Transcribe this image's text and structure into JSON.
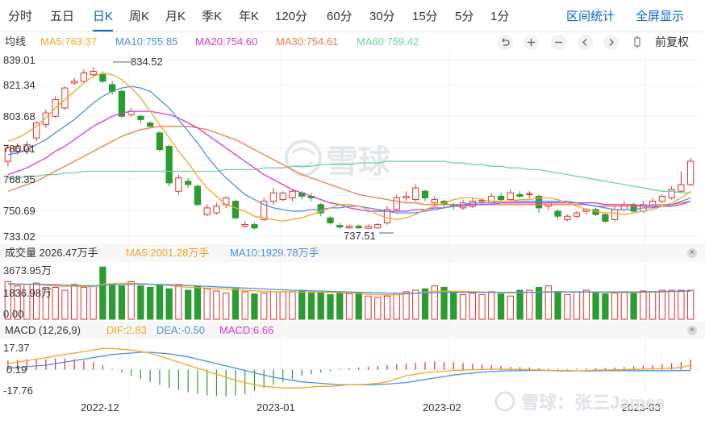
{
  "tabs": [
    {
      "label": "分时",
      "active": false
    },
    {
      "label": "五日",
      "active": false
    },
    {
      "label": "日K",
      "active": true
    },
    {
      "label": "周K",
      "active": false
    },
    {
      "label": "月K",
      "active": false
    },
    {
      "label": "季K",
      "active": false
    },
    {
      "label": "年K",
      "active": false
    },
    {
      "label": "120分",
      "active": false
    },
    {
      "label": "60分",
      "active": false
    },
    {
      "label": "30分",
      "active": false
    },
    {
      "label": "15分",
      "active": false
    },
    {
      "label": "5分",
      "active": false
    },
    {
      "label": "1分",
      "active": false
    }
  ],
  "tools": {
    "interval_stats": "区间统计",
    "fullscreen": "全屏显示"
  },
  "ma_bar": {
    "title": "均线",
    "ma5": "MA5:763.37",
    "ma10": "MA10:755.85",
    "ma20": "MA20:754.60",
    "ma30": "MA30:754.61",
    "ma60": "MA60:759.42",
    "adjust": "前复权"
  },
  "controls": [
    "undo-icon",
    "zoom-in-icon",
    "zoom-out-icon",
    "chevron-left-icon",
    "chevron-right-icon",
    "drag-handle-icon"
  ],
  "price_axis": [
    "839.01",
    "821.34",
    "803.68",
    "786.01",
    "768.35",
    "750.69",
    "733.02"
  ],
  "annotations": {
    "high": "834.52",
    "low": "737.51"
  },
  "watermark": "雪球",
  "volume": {
    "title": "成交量 2026.47万手",
    "ma5": "MA5:2001.28万手",
    "ma10": "MA10:1929.78万手",
    "axis_top": "3673.95万",
    "axis_mid": "1836.98万",
    "axis_bottom": "0.00"
  },
  "macd": {
    "title": "MACD (12,26,9)",
    "dif": "DIF:2.83",
    "dea": "DEA:-0.50",
    "macd": "MACD:6.66",
    "axis_top": "17.37",
    "axis_mid": "0.19",
    "axis_bottom": "-17.76"
  },
  "x_axis": [
    "2022-12",
    "2023-01",
    "2023-02",
    "2023-03"
  ],
  "footer_watermark": "雪球：张三James",
  "colors": {
    "up": "#e0312e",
    "down": "#2a9c30",
    "accent": "#0066cc",
    "ma5": "#f5a623",
    "ma10": "#4a90e2",
    "ma20": "#d63ad1",
    "ma30": "#f07c4c",
    "ma60": "#6fd39a"
  },
  "chart_data": {
    "type": "candlestick",
    "price_range": [
      733.02,
      839.01
    ],
    "candles": [
      {
        "o": 778,
        "c": 786,
        "h": 788,
        "l": 775
      },
      {
        "o": 784,
        "c": 787,
        "h": 789,
        "l": 782
      },
      {
        "o": 784,
        "c": 788,
        "h": 790,
        "l": 782
      },
      {
        "o": 792,
        "c": 801,
        "h": 802,
        "l": 790
      },
      {
        "o": 800,
        "c": 807,
        "h": 809,
        "l": 798
      },
      {
        "o": 805,
        "c": 815,
        "h": 817,
        "l": 804
      },
      {
        "o": 810,
        "c": 822,
        "h": 823,
        "l": 809
      },
      {
        "o": 825,
        "c": 826,
        "h": 828,
        "l": 824
      },
      {
        "o": 826,
        "c": 831,
        "h": 833,
        "l": 825
      },
      {
        "o": 830,
        "c": 832,
        "h": 834.52,
        "l": 829
      },
      {
        "o": 830,
        "c": 826,
        "h": 832,
        "l": 825
      },
      {
        "o": 824,
        "c": 820,
        "h": 826,
        "l": 818
      },
      {
        "o": 820,
        "c": 805,
        "h": 821,
        "l": 804
      },
      {
        "o": 806,
        "c": 808,
        "h": 810,
        "l": 805
      },
      {
        "o": 805,
        "c": 803,
        "h": 806,
        "l": 801
      },
      {
        "o": 801,
        "c": 799,
        "h": 802,
        "l": 798
      },
      {
        "o": 795,
        "c": 785,
        "h": 796,
        "l": 784
      },
      {
        "o": 787,
        "c": 765,
        "h": 788,
        "l": 763
      },
      {
        "o": 760,
        "c": 768,
        "h": 770,
        "l": 758
      },
      {
        "o": 766,
        "c": 764,
        "h": 768,
        "l": 762
      },
      {
        "o": 763,
        "c": 752,
        "h": 764,
        "l": 751
      },
      {
        "o": 746,
        "c": 750,
        "h": 752,
        "l": 745
      },
      {
        "o": 747,
        "c": 751,
        "h": 753,
        "l": 746
      },
      {
        "o": 752,
        "c": 756,
        "h": 757,
        "l": 750
      },
      {
        "o": 754,
        "c": 744,
        "h": 755,
        "l": 743
      },
      {
        "o": 739,
        "c": 740,
        "h": 742,
        "l": 738
      },
      {
        "o": 740,
        "c": 738,
        "h": 741,
        "l": 737
      },
      {
        "o": 743,
        "c": 754,
        "h": 756,
        "l": 742
      },
      {
        "o": 754,
        "c": 759,
        "h": 762,
        "l": 752
      },
      {
        "o": 755,
        "c": 759,
        "h": 760,
        "l": 754
      },
      {
        "o": 756,
        "c": 760,
        "h": 761,
        "l": 754
      },
      {
        "o": 759,
        "c": 757,
        "h": 760,
        "l": 755
      },
      {
        "o": 757,
        "c": 756,
        "h": 759,
        "l": 754
      },
      {
        "o": 752,
        "c": 747,
        "h": 753,
        "l": 745
      },
      {
        "o": 744,
        "c": 741,
        "h": 745,
        "l": 740
      },
      {
        "o": 739.5,
        "c": 738.5,
        "h": 741,
        "l": 737.51
      },
      {
        "o": 738,
        "c": 739,
        "h": 740,
        "l": 737.51
      },
      {
        "o": 739,
        "c": 738,
        "h": 740,
        "l": 737.51
      },
      {
        "o": 737.8,
        "c": 739,
        "h": 740,
        "l": 737.51
      },
      {
        "o": 738,
        "c": 740,
        "h": 741,
        "l": 737.6
      },
      {
        "o": 741,
        "c": 749,
        "h": 751,
        "l": 740
      },
      {
        "o": 749,
        "c": 756,
        "h": 758,
        "l": 748
      },
      {
        "o": 756,
        "c": 757,
        "h": 760,
        "l": 754
      },
      {
        "o": 755,
        "c": 762,
        "h": 764,
        "l": 754
      },
      {
        "o": 760,
        "c": 756,
        "h": 761,
        "l": 754
      },
      {
        "o": 753,
        "c": 755,
        "h": 757,
        "l": 751
      },
      {
        "o": 754,
        "c": 752,
        "h": 755,
        "l": 750
      },
      {
        "o": 752,
        "c": 751,
        "h": 753,
        "l": 749
      },
      {
        "o": 750,
        "c": 753,
        "h": 755,
        "l": 749
      },
      {
        "o": 751,
        "c": 754,
        "h": 756,
        "l": 750
      },
      {
        "o": 754,
        "c": 754.5,
        "h": 756,
        "l": 752
      },
      {
        "o": 753,
        "c": 757,
        "h": 759,
        "l": 752
      },
      {
        "o": 757,
        "c": 755,
        "h": 759,
        "l": 754
      },
      {
        "o": 755,
        "c": 759,
        "h": 761,
        "l": 754
      },
      {
        "o": 758,
        "c": 757,
        "h": 760,
        "l": 756
      },
      {
        "o": 758,
        "c": 758.5,
        "h": 760,
        "l": 756
      },
      {
        "o": 757,
        "c": 750,
        "h": 758,
        "l": 747
      },
      {
        "o": 751,
        "c": 753,
        "h": 754,
        "l": 749
      },
      {
        "o": 748,
        "c": 745,
        "h": 749,
        "l": 743
      },
      {
        "o": 743,
        "c": 745,
        "h": 746,
        "l": 742
      },
      {
        "o": 745,
        "c": 747,
        "h": 748,
        "l": 744
      },
      {
        "o": 748,
        "c": 749,
        "h": 750,
        "l": 746
      },
      {
        "o": 749,
        "c": 746,
        "h": 750,
        "l": 745
      },
      {
        "o": 746,
        "c": 742,
        "h": 747,
        "l": 741
      },
      {
        "o": 743,
        "c": 749,
        "h": 751,
        "l": 742
      },
      {
        "o": 749,
        "c": 752,
        "h": 754,
        "l": 748
      },
      {
        "o": 752,
        "c": 748,
        "h": 753,
        "l": 747
      },
      {
        "o": 748,
        "c": 752,
        "h": 754,
        "l": 747
      },
      {
        "o": 751,
        "c": 754,
        "h": 756,
        "l": 750
      },
      {
        "o": 754,
        "c": 757,
        "h": 758,
        "l": 753
      },
      {
        "o": 756,
        "c": 761,
        "h": 763,
        "l": 755
      },
      {
        "o": 760,
        "c": 764,
        "h": 772,
        "l": 759
      },
      {
        "o": 764,
        "c": 778,
        "h": 780,
        "l": 763
      }
    ],
    "ma5": [
      790,
      792,
      795,
      799,
      804,
      810,
      815,
      820,
      825,
      829,
      831,
      830,
      827,
      822,
      816,
      808,
      800,
      792,
      784,
      777,
      769,
      762,
      757,
      752,
      750,
      748,
      745,
      744,
      743,
      742,
      743,
      744,
      746,
      748,
      750,
      752,
      752,
      751,
      749,
      746,
      744,
      743,
      744,
      746,
      749,
      751,
      753,
      755,
      756,
      756,
      755,
      754,
      754,
      754,
      755,
      755,
      756,
      756,
      755,
      753,
      751,
      749,
      748,
      747,
      747,
      746,
      747,
      748,
      749,
      751,
      753,
      756,
      760
    ],
    "ma10": [
      782,
      783,
      785,
      788,
      791,
      795,
      799,
      803,
      808,
      813,
      817,
      820,
      822,
      823,
      822,
      820,
      815,
      810,
      803,
      796,
      789,
      781,
      774,
      768,
      763,
      758,
      755,
      752,
      750,
      749,
      748,
      748,
      749,
      749,
      750,
      750,
      751,
      751,
      750,
      749,
      748,
      747,
      747,
      747,
      748,
      749,
      750,
      751,
      752,
      753,
      753,
      753,
      754,
      754,
      754,
      754,
      754,
      754,
      754,
      754,
      753,
      752,
      751,
      750,
      749,
      749,
      749,
      750,
      750,
      751,
      752,
      754,
      756
    ],
    "ma20": [
      770,
      772,
      774,
      777,
      780,
      784,
      787,
      791,
      795,
      799,
      802,
      805,
      807,
      808,
      808,
      808,
      807,
      806,
      804,
      801,
      798,
      794,
      790,
      786,
      782,
      778,
      774,
      770,
      767,
      764,
      761,
      759,
      757,
      755,
      753,
      752,
      750,
      749,
      748,
      748,
      748,
      748,
      748,
      749,
      749,
      750,
      750,
      751,
      751,
      752,
      752,
      752,
      753,
      753,
      753,
      753,
      753,
      753,
      753,
      753,
      753,
      753,
      753,
      752,
      752,
      752,
      752,
      751,
      751,
      751,
      751,
      752,
      754
    ],
    "ma30": [
      760,
      762,
      764,
      766,
      769,
      772,
      775,
      778,
      781,
      784,
      787,
      790,
      793,
      795,
      797,
      798,
      799,
      799,
      799,
      799,
      798,
      797,
      795,
      793,
      791,
      788,
      785,
      782,
      779,
      776,
      773,
      770,
      768,
      766,
      764,
      762,
      760,
      758,
      757,
      756,
      755,
      754,
      753,
      753,
      752,
      752,
      752,
      752,
      752,
      752,
      752,
      752,
      752,
      752,
      752,
      752,
      752,
      752,
      752,
      752,
      752,
      752,
      751,
      751,
      751,
      751,
      751,
      751,
      752,
      752,
      752,
      753,
      754
    ],
    "ma60": [
      768,
      768,
      769,
      769,
      770,
      770,
      771,
      771,
      772,
      772,
      772,
      772,
      772,
      772,
      772,
      772,
      772,
      772,
      772,
      772,
      772,
      772,
      772,
      773,
      773,
      773,
      773,
      774,
      774,
      774,
      775,
      775,
      775,
      776,
      776,
      776,
      776,
      777,
      777,
      777,
      778,
      778,
      778,
      778,
      778,
      778,
      778,
      777,
      777,
      776,
      776,
      775,
      775,
      774,
      774,
      773,
      773,
      772,
      771,
      770,
      769,
      768,
      767,
      766,
      765,
      764,
      763,
      762,
      761,
      760,
      760,
      759,
      759
    ],
    "volume": [
      2600,
      2300,
      2400,
      2500,
      2200,
      2200,
      2000,
      2400,
      2200,
      2300,
      3600,
      2400,
      2300,
      2600,
      2300,
      2200,
      2400,
      2100,
      2400,
      2000,
      2300,
      2100,
      1950,
      1800,
      2100,
      1900,
      1750,
      1800,
      1900,
      1900,
      1900,
      2000,
      1800,
      1850,
      1700,
      1800,
      1750,
      1850,
      1600,
      1500,
      1600,
      1800,
      1900,
      2000,
      2100,
      2300,
      2200,
      1900,
      1700,
      1800,
      1700,
      1900,
      1750,
      1600,
      2000,
      2000,
      2200,
      2300,
      1850,
      1700,
      1900,
      2000,
      1850,
      1750,
      1800,
      1900,
      1800,
      1950,
      1900,
      2000,
      2000,
      2000,
      2000
    ],
    "volume_ma5": [
      2400,
      2400,
      2400,
      2400,
      2350,
      2300,
      2260,
      2280,
      2250,
      2260,
      2420,
      2460,
      2480,
      2480,
      2460,
      2420,
      2380,
      2320,
      2260,
      2210,
      2180,
      2150,
      2110,
      2080,
      2040,
      2000,
      1960,
      1920,
      1900,
      1880,
      1870,
      1870,
      1870,
      1860,
      1850,
      1830,
      1800,
      1760,
      1720,
      1690,
      1680,
      1690,
      1730,
      1800,
      1870,
      1920,
      1940,
      1930,
      1920,
      1900,
      1880,
      1860,
      1840,
      1820,
      1830,
      1850,
      1870,
      1900,
      1920,
      1900,
      1880,
      1870,
      1860,
      1850,
      1840,
      1830,
      1830,
      1840,
      1860,
      1880,
      1900,
      1920,
      1950
    ],
    "volume_ma10": [
      2450,
      2430,
      2420,
      2410,
      2400,
      2380,
      2360,
      2340,
      2320,
      2300,
      2330,
      2360,
      2390,
      2410,
      2420,
      2410,
      2400,
      2380,
      2350,
      2330,
      2300,
      2270,
      2240,
      2210,
      2180,
      2150,
      2120,
      2090,
      2060,
      2030,
      2000,
      1980,
      1960,
      1940,
      1920,
      1900,
      1880,
      1860,
      1840,
      1820,
      1800,
      1790,
      1790,
      1800,
      1810,
      1830,
      1850,
      1860,
      1860,
      1860,
      1860,
      1860,
      1860,
      1860,
      1860,
      1860,
      1860,
      1870,
      1880,
      1880,
      1880,
      1880,
      1880,
      1880,
      1880,
      1880,
      1880,
      1890,
      1900,
      1910,
      1920,
      1930,
      1940
    ],
    "macd_hist": [
      6,
      6.5,
      7,
      7,
      7,
      7.5,
      7.5,
      7,
      6,
      5,
      3,
      0.5,
      -2,
      -4,
      -6,
      -8,
      -10,
      -12,
      -13.5,
      -15,
      -16,
      -17,
      -17.5,
      -17.76,
      -17,
      -16,
      -14,
      -12,
      -10,
      -8,
      -6,
      -4,
      -3,
      -2,
      -1,
      0.5,
      1,
      1.5,
      2,
      2.5,
      3,
      3.5,
      4,
      4.5,
      5,
      5.5,
      5.2,
      5,
      4.5,
      4,
      3.5,
      3,
      2.5,
      2,
      1.8,
      1.5,
      1,
      0.8,
      0.5,
      0.4,
      0.6,
      0.8,
      1,
      1.2,
      1.5,
      1.8,
      2.2,
      2.6,
      3,
      3.6,
      4.2,
      5,
      6.66
    ],
    "dif": [
      4,
      5,
      6,
      7,
      8,
      9,
      10,
      11,
      12,
      13,
      14,
      14,
      13.5,
      13,
      12,
      11,
      9,
      7,
      5,
      3,
      1,
      -1,
      -3,
      -5,
      -7,
      -8.5,
      -10,
      -11,
      -11.5,
      -12,
      -12,
      -12,
      -11.5,
      -11,
      -11,
      -10.5,
      -10,
      -10,
      -9.5,
      -9,
      -8,
      -6,
      -4,
      -3,
      -2,
      -1.5,
      -1,
      -0.5,
      -0.3,
      0,
      0.2,
      0.3,
      0.3,
      0.2,
      0.1,
      0,
      -0.2,
      -0.5,
      -0.8,
      -1,
      -0.8,
      -0.5,
      -0.3,
      -0.2,
      -0.1,
      0,
      0.2,
      0.4,
      0.6,
      0.8,
      1,
      1.5,
      2.83
    ],
    "dea": [
      1,
      1.5,
      2,
      2.5,
      3,
      4,
      5,
      6,
      7,
      8,
      9,
      10,
      10.5,
      11,
      11.5,
      11.5,
      11,
      10.5,
      9.5,
      8.5,
      7,
      5.5,
      4,
      2.5,
      1,
      -0.5,
      -2,
      -3.5,
      -5,
      -6,
      -7,
      -8,
      -8.5,
      -9,
      -9.5,
      -10,
      -10,
      -10,
      -10,
      -9.8,
      -9.5,
      -9,
      -8.5,
      -7.5,
      -6.5,
      -5.5,
      -4.5,
      -3.5,
      -2.8,
      -2.2,
      -1.6,
      -1.2,
      -0.9,
      -0.7,
      -0.6,
      -0.5,
      -0.5,
      -0.5,
      -0.6,
      -0.7,
      -0.8,
      -0.8,
      -0.8,
      -0.7,
      -0.7,
      -0.6,
      -0.6,
      -0.6,
      -0.6,
      -0.6,
      -0.6,
      -0.55,
      -0.5
    ],
    "volume_range": [
      0,
      3673.95
    ],
    "macd_range": [
      -17.76,
      17.37
    ],
    "x_ticks": [
      "2022-12",
      "2023-01",
      "2023-02",
      "2023-03"
    ]
  }
}
